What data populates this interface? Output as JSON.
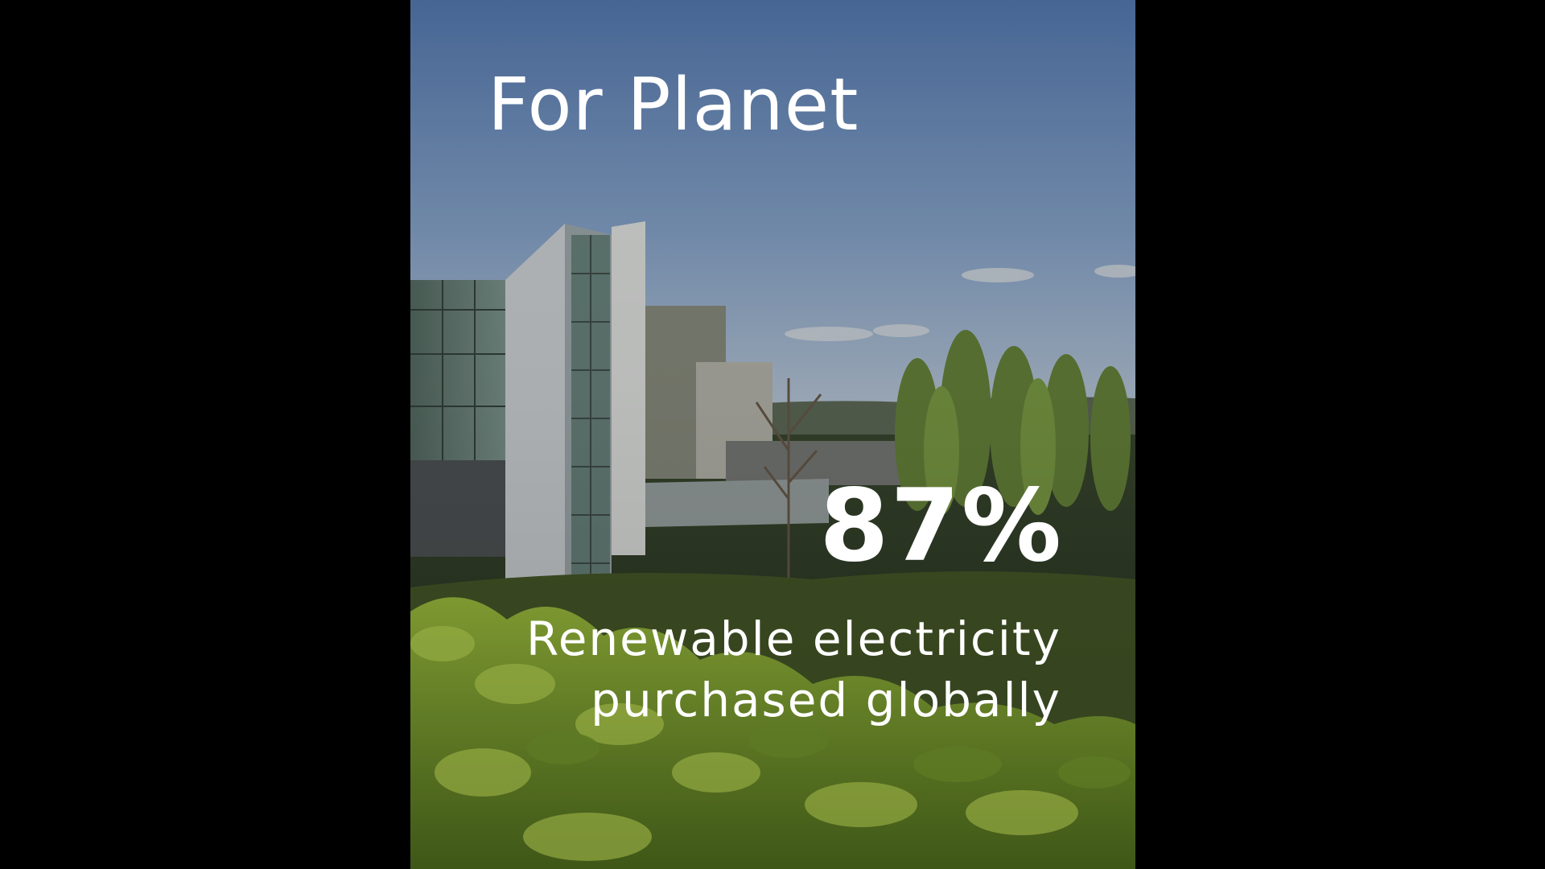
{
  "slide": {
    "title": "For Planet",
    "stat_value": "87%",
    "stat_caption_line1": "Renewable electricity",
    "stat_caption_line2": "purchased globally",
    "progress_percent": 87
  },
  "colors": {
    "letterbox": "#000000",
    "sky_top": "#4d6e9e",
    "sky_bottom": "#8aa0bd",
    "foliage": "#7c9a2e",
    "text": "#ffffff"
  },
  "photo": {
    "subject": "modern-office-building-with-trees-and-greenery"
  }
}
